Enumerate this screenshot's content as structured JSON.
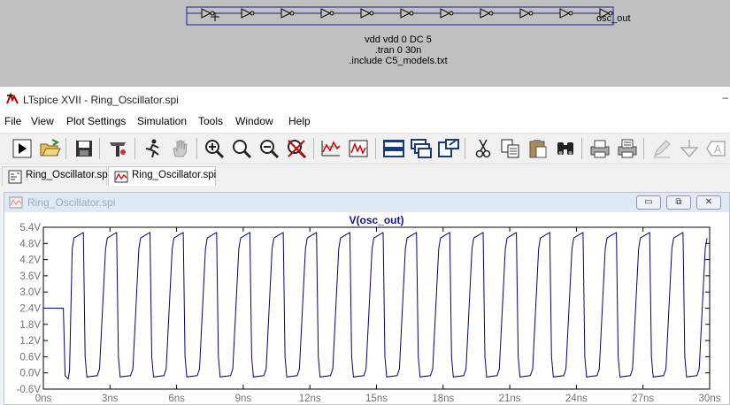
{
  "schematic": {
    "net_label": "osc_out",
    "directives": [
      "vdd vdd 0 DC 5",
      ".tran 0 30n",
      ".include C5_models.txt"
    ]
  },
  "window": {
    "title": "LTspice XVII - Ring_Oscillator.spi"
  },
  "menu": [
    "File",
    "View",
    "Plot Settings",
    "Simulation",
    "Tools",
    "Window",
    "Help"
  ],
  "toolbar": {
    "icons": [
      "run-icon",
      "open-icon",
      "save-icon",
      "control-panel-icon",
      "halt-icon",
      "pan-icon",
      "zoom-in-icon",
      "zoom-area-icon",
      "zoom-out-icon",
      "zoom-cancel-icon",
      "autorange-icon",
      "fft-icon",
      "tile-horizontal-icon",
      "cascade-icon",
      "tile-vertical-icon",
      "cut-icon",
      "copy-icon",
      "paste-icon",
      "find-icon",
      "print-icon",
      "print-setup-icon",
      "pencil-icon",
      "ground-icon",
      "label-icon"
    ]
  },
  "tabs": [
    {
      "label": "Ring_Oscillator.spi",
      "icon": "schematic-icon",
      "active": false
    },
    {
      "label": "Ring_Oscillator.spi",
      "icon": "waveform-icon",
      "active": true
    }
  ],
  "plot_window": {
    "title": "Ring_Oscillator.spi",
    "buttons": [
      "minimize",
      "restore",
      "close"
    ]
  },
  "chart_data": {
    "type": "line",
    "title": "V(osc_out)",
    "xlabel": "",
    "ylabel": "",
    "xlim": [
      0,
      30
    ],
    "ylim": [
      -0.6,
      5.4
    ],
    "x_ticks": [
      "0ns",
      "3ns",
      "6ns",
      "9ns",
      "12ns",
      "15ns",
      "18ns",
      "21ns",
      "24ns",
      "27ns",
      "30ns"
    ],
    "y_ticks": [
      "5.4V",
      "4.8V",
      "4.2V",
      "3.6V",
      "3.0V",
      "2.4V",
      "1.8V",
      "1.2V",
      "0.6V",
      "0.0V",
      "-0.6V"
    ],
    "grid": false,
    "color": "#000080",
    "series": [
      {
        "name": "V(osc_out)",
        "x_unit": "ns",
        "initial_level": 2.4,
        "start_time": 0.9,
        "period": 1.5,
        "high_level": 5.2,
        "low_level": -0.1,
        "end_time": 30
      }
    ]
  }
}
